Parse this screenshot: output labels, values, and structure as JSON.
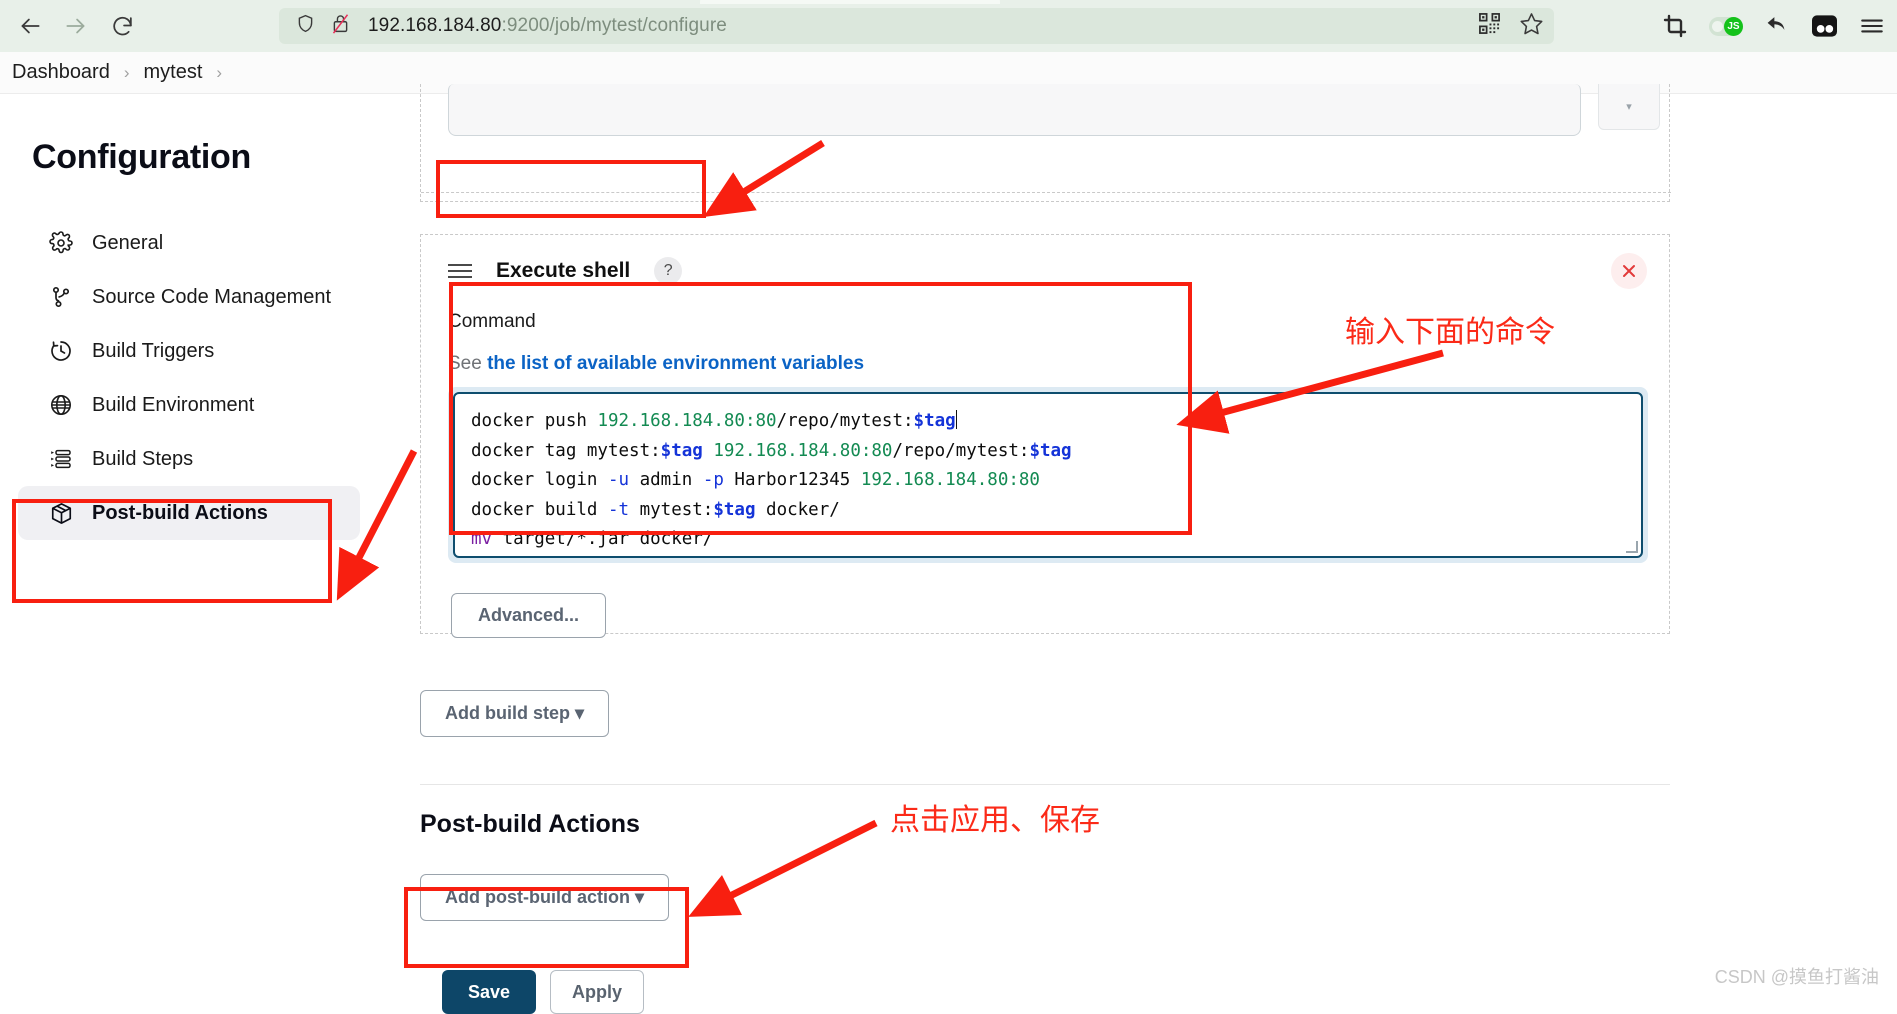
{
  "browser": {
    "back_icon": "arrow-left-icon",
    "forward_icon": "arrow-right-icon",
    "reload_icon": "reload-icon",
    "shield_icon": "shield-icon",
    "insecure_icon": "lock-crossed-icon",
    "url_host": "192.168.184.80",
    "url_rest": ":9200/job/mytest/configure",
    "qr_icon": "qr-code-icon",
    "bookmark_icon": "star-icon",
    "toolbar_icons": [
      "crop-icon",
      "javascript-toggle",
      "undo-arrow-icon",
      "reader-panel-icon",
      "hamburger-menu-icon"
    ],
    "js_toggle_label": "JS"
  },
  "breadcrumb": {
    "items": [
      "Dashboard",
      "mytest"
    ],
    "separator": "›"
  },
  "sidebar": {
    "title": "Configuration",
    "items": [
      {
        "label": "General",
        "icon": "gear-icon",
        "active": false
      },
      {
        "label": "Source Code Management",
        "icon": "git-branch-icon",
        "active": false
      },
      {
        "label": "Build Triggers",
        "icon": "clock-icon",
        "active": false
      },
      {
        "label": "Build Environment",
        "icon": "globe-icon",
        "active": false
      },
      {
        "label": "Build Steps",
        "icon": "list-steps-icon",
        "active": false
      },
      {
        "label": "Post-build Actions",
        "icon": "package-box-icon",
        "active": true
      }
    ]
  },
  "main": {
    "shell_step": {
      "drag_handle_icon": "drag-handle-icon",
      "title": "Execute shell",
      "help_label": "?",
      "close_icon": "close-icon",
      "command_label": "Command",
      "env_prefix": "See ",
      "env_link": "the list of available environment variables",
      "command_lines": [
        [
          {
            "t": "mv",
            "c": "kw"
          },
          {
            "t": " target/*.jar docker/",
            "c": ""
          }
        ],
        [
          {
            "t": "docker build ",
            "c": ""
          },
          {
            "t": "-t",
            "c": "flag"
          },
          {
            "t": " mytest:",
            "c": ""
          },
          {
            "t": "$tag",
            "c": "var"
          },
          {
            "t": " docker/",
            "c": ""
          }
        ],
        [
          {
            "t": "docker login ",
            "c": ""
          },
          {
            "t": "-u",
            "c": "flag"
          },
          {
            "t": " admin ",
            "c": ""
          },
          {
            "t": "-p",
            "c": "flag"
          },
          {
            "t": " Harbor12345 ",
            "c": ""
          },
          {
            "t": "192.168.184.80:80",
            "c": "num"
          }
        ],
        [
          {
            "t": "docker tag mytest:",
            "c": ""
          },
          {
            "t": "$tag",
            "c": "var"
          },
          {
            "t": " ",
            "c": ""
          },
          {
            "t": "192.168.184.80:80",
            "c": "num"
          },
          {
            "t": "/repo/mytest:",
            "c": ""
          },
          {
            "t": "$tag",
            "c": "var"
          }
        ],
        [
          {
            "t": "docker push ",
            "c": ""
          },
          {
            "t": "192.168.184.80:80",
            "c": "num"
          },
          {
            "t": "/repo/mytest:",
            "c": ""
          },
          {
            "t": "$tag",
            "c": "var"
          }
        ]
      ],
      "command_plain": "mv target/*.jar docker/\ndocker build -t mytest:$tag docker/\ndocker login -u admin -p Harbor12345 192.168.184.80:80\ndocker tag mytest:$tag 192.168.184.80:80/repo/mytest:$tag\ndocker push 192.168.184.80:80/repo/mytest:$tag",
      "advanced_label": "Advanced..."
    },
    "add_build_step_label": "Add build step",
    "post_build_title": "Post-build Actions",
    "add_post_build_label": "Add post-build action",
    "save_label": "Save",
    "apply_label": "Apply",
    "dropdown_caret": "▾"
  },
  "annotations": {
    "color": "#f81f10",
    "note_command": "输入下面的命令",
    "note_save": "点击应用、保存"
  },
  "watermark": "CSDN @摸鱼打酱油",
  "colors": {
    "browser_bg": "#e8f0e9",
    "save_button": "#0d4668",
    "link": "#0b63c5",
    "annotation_red": "#f81f10",
    "active_nav_bg": "#f0f0f3"
  }
}
